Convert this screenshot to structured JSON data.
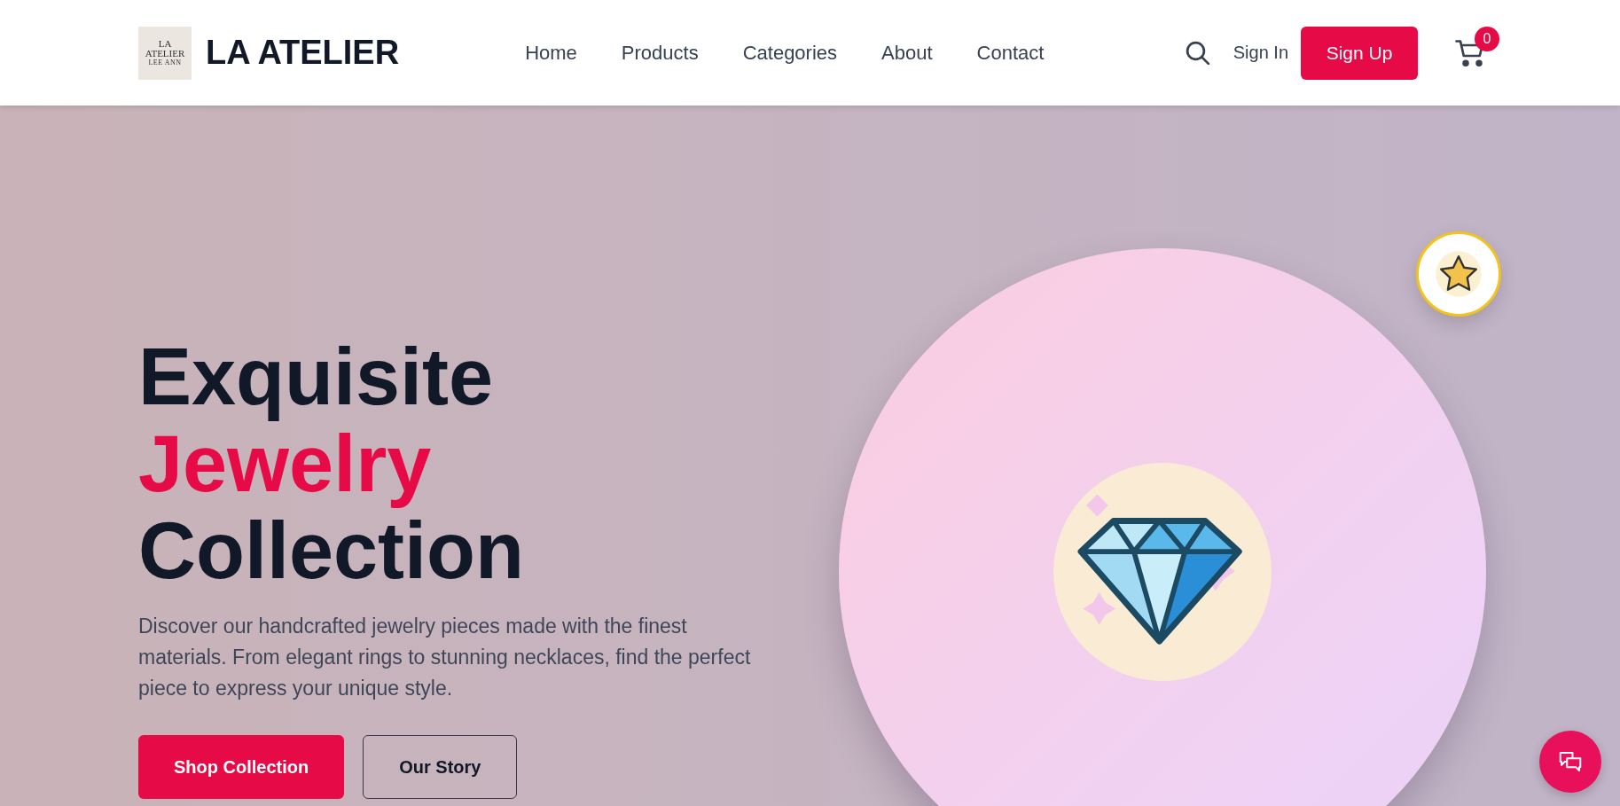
{
  "header": {
    "logo": {
      "lines": [
        "LA",
        "ATELIER",
        "LEE ANN"
      ]
    },
    "brand": "LA ATELIER",
    "nav": [
      {
        "label": "Home"
      },
      {
        "label": "Products"
      },
      {
        "label": "Categories"
      },
      {
        "label": "About"
      },
      {
        "label": "Contact"
      }
    ],
    "sign_in": "Sign In",
    "sign_up": "Sign Up",
    "cart_count": "0"
  },
  "hero": {
    "title_lines": [
      {
        "text": "Exquisite",
        "accent": false
      },
      {
        "text": "Jewelry",
        "accent": true
      },
      {
        "text": "Collection",
        "accent": false
      }
    ],
    "description": "Discover our handcrafted jewelry pieces made with the finest materials. From elegant rings to stunning necklaces, find the perfect piece to express your unique style.",
    "buttons": [
      {
        "label": "Shop Collection",
        "kind": "primary"
      },
      {
        "label": "Our Story",
        "kind": "outline"
      }
    ]
  }
}
